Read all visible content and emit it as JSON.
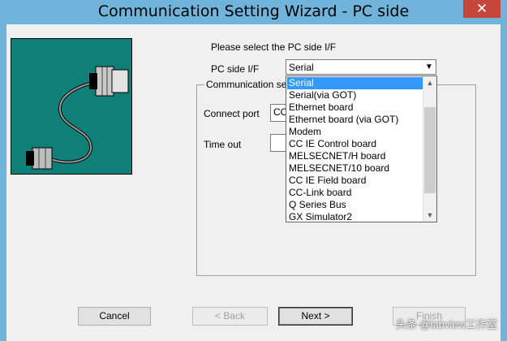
{
  "window": {
    "title": "Communication Setting Wizard - PC side",
    "close_glyph": "✕"
  },
  "prompt": "Please select the PC side I/F",
  "pc_if": {
    "label": "PC side I/F",
    "value": "Serial"
  },
  "group": {
    "label": "Communication se",
    "connect_port_label": "Connect port",
    "connect_port_value": "CC",
    "timeout_label": "Time out",
    "timeout_value": ""
  },
  "dropdown": {
    "options": [
      "Serial",
      "Serial(via GOT)",
      "Ethernet board",
      "Ethernet board (via GOT)",
      "Modem",
      "CC IE Control board",
      "MELSECNET/H board",
      "MELSECNET/10 board",
      "CC IE Field board",
      "CC-Link board",
      "Q Series Bus",
      "GX Simulator2"
    ],
    "selected_index": 0
  },
  "buttons": {
    "cancel": "Cancel",
    "back": "< Back",
    "next": "Next >",
    "finish": "Finish"
  },
  "watermark": "头条 @labview工作室",
  "colors": {
    "titlebar": "#70b4dc",
    "picture_bg": "#0e8078",
    "selection": "#3399ff",
    "close": "#c7463b"
  },
  "icons": {
    "picture": "serial-cable-illustration",
    "combo_arrow": "chevron-down-icon",
    "close": "close-icon"
  }
}
